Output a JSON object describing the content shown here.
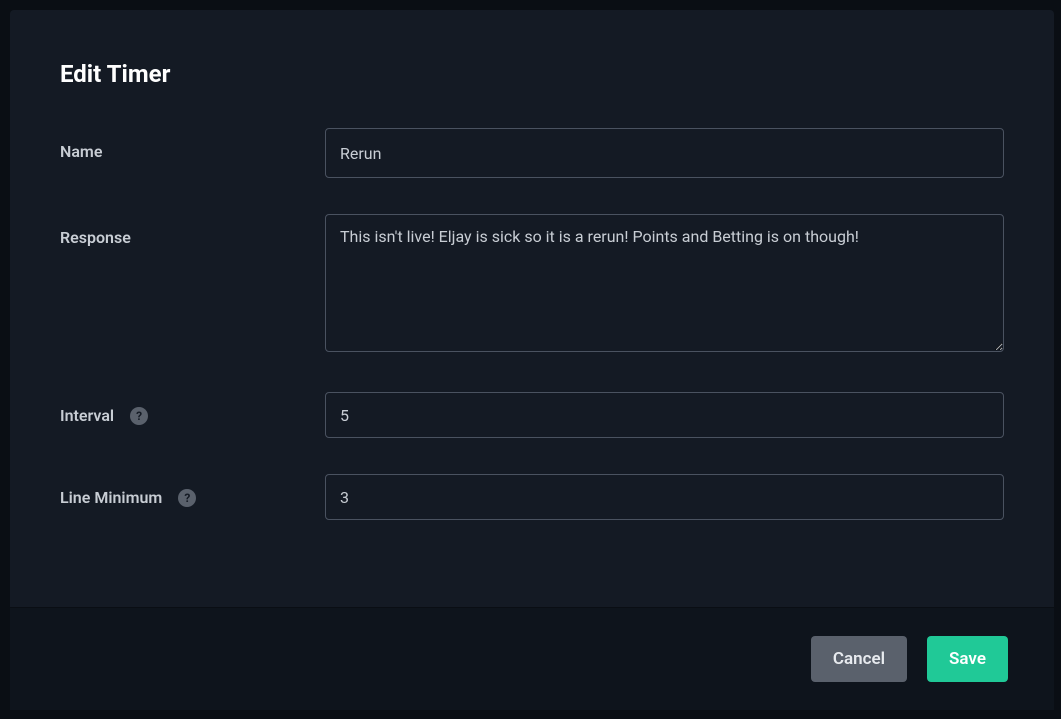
{
  "modal": {
    "title": "Edit Timer"
  },
  "form": {
    "name": {
      "label": "Name",
      "value": "Rerun"
    },
    "response": {
      "label": "Response",
      "value": "This isn't live! Eljay is sick so it is a rerun! Points and Betting is on though!"
    },
    "interval": {
      "label": "Interval",
      "value": "5",
      "help": "?"
    },
    "lineMinimum": {
      "label": "Line Minimum",
      "value": "3",
      "help": "?"
    }
  },
  "footer": {
    "cancel": "Cancel",
    "save": "Save"
  }
}
